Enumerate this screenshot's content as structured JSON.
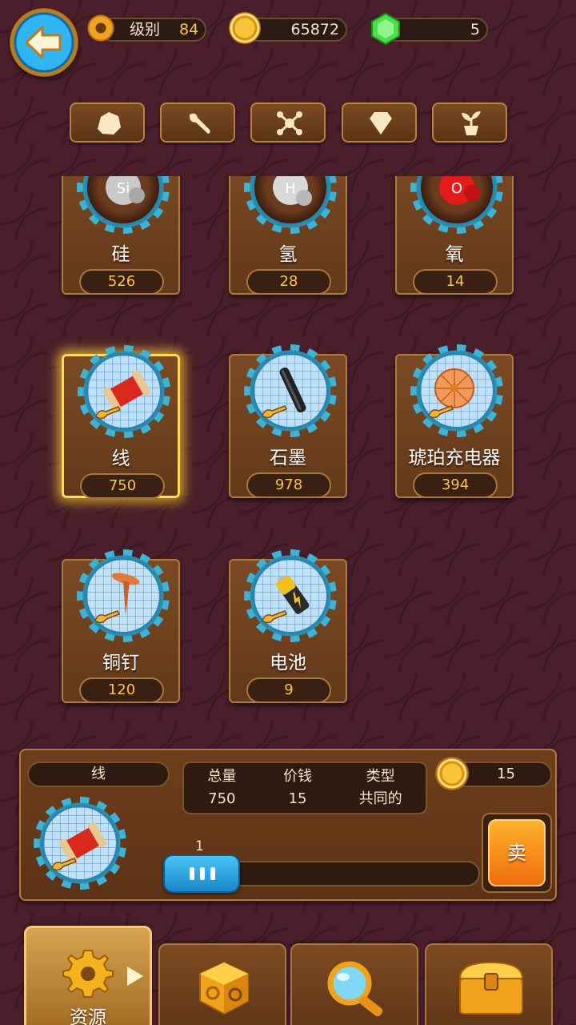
{
  "top_bar": {
    "level_label": "级别",
    "level_value": "84",
    "coins": "65872",
    "gems": "5"
  },
  "categories": [
    {
      "icon": "rock-icon"
    },
    {
      "icon": "wrench-icon"
    },
    {
      "icon": "molecule-icon"
    },
    {
      "icon": "diamond-icon"
    },
    {
      "icon": "sprout-icon"
    }
  ],
  "items": [
    {
      "name": "硅",
      "count": "526",
      "icon": "silicon-element-icon",
      "symbol": "Si"
    },
    {
      "name": "氢",
      "count": "28",
      "icon": "hydrogen-element-icon",
      "symbol": "H"
    },
    {
      "name": "氧",
      "count": "14",
      "icon": "oxygen-element-icon",
      "symbol": "O"
    },
    {
      "name": "线",
      "count": "750",
      "icon": "thread-spool-icon",
      "selected": true
    },
    {
      "name": "石墨",
      "count": "978",
      "icon": "graphite-rod-icon"
    },
    {
      "name": "琥珀充电器",
      "count": "394",
      "icon": "amber-charger-icon"
    },
    {
      "name": "铜钉",
      "count": "120",
      "icon": "copper-nail-icon"
    },
    {
      "name": "电池",
      "count": "9",
      "icon": "battery-icon"
    }
  ],
  "detail": {
    "name": "线",
    "total_label": "总量",
    "total_value": "750",
    "price_label": "价钱",
    "price_value": "15",
    "type_label": "类型",
    "type_value": "共同的",
    "sell_price": "15",
    "quantity": "1",
    "slider_level": 0.0,
    "sell_label": "卖"
  },
  "bottom_tabs": [
    {
      "label": "资源",
      "icon": "gear-icon",
      "active": true
    },
    {
      "label": "",
      "icon": "mystery-cube-icon"
    },
    {
      "label": "",
      "icon": "magnifier-icon"
    },
    {
      "label": "",
      "icon": "treasure-chest-icon"
    }
  ],
  "colors": {
    "background": "#4a1f2b",
    "card": "#6e3e1c",
    "accent_gold": "#f7c54a",
    "highlight": "#ffd95a",
    "slider_blue": "#2fb6f2",
    "sell_orange": "#ef6c0c"
  }
}
